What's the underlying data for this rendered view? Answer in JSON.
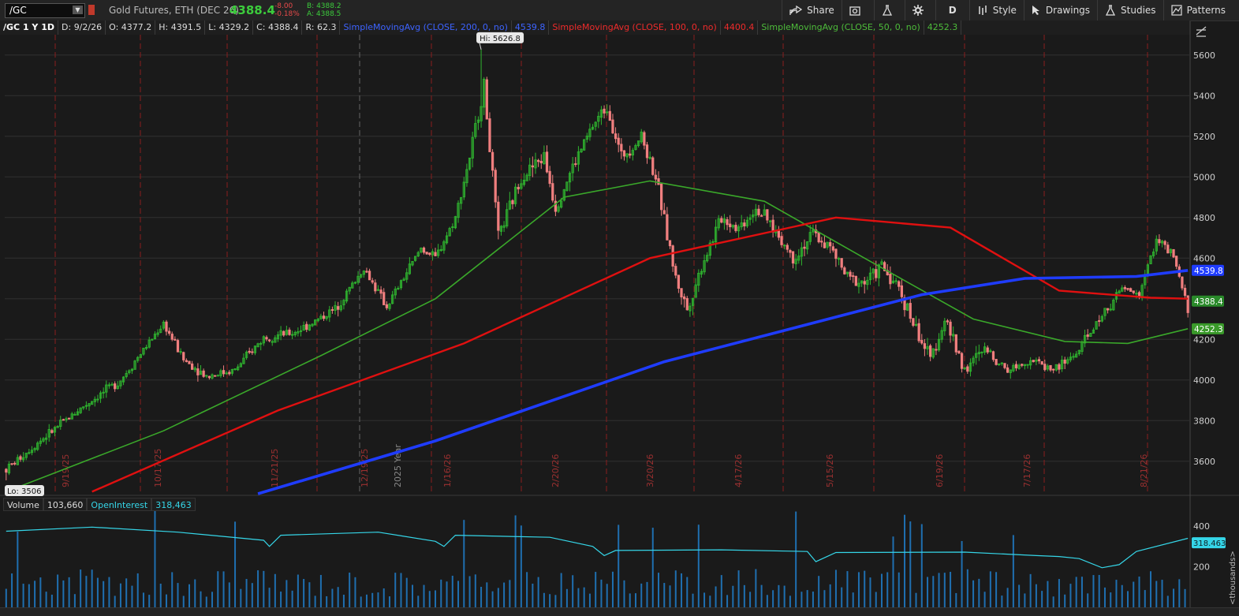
{
  "toolbar": {
    "symbol": "/GC",
    "instrument": "Gold Futures, ETH (DEC 26)",
    "last": "4388.4",
    "change": "-8.00",
    "change_pct": "-0.18%",
    "bid": "B: 4388.2",
    "ask": "A: 4388.5",
    "share": "Share",
    "period": "D",
    "style": "Style",
    "drawings": "Drawings",
    "studies": "Studies",
    "patterns": "Patterns"
  },
  "header": {
    "label": "/GC 1 Y 1D",
    "date": "D: 9/2/26",
    "open": "O: 4377.2",
    "high": "H: 4391.5",
    "low": "L: 4329.2",
    "close": "C: 4388.4",
    "range": "R: 62.3",
    "sma200_label": "SimpleMovingAvg (CLOSE, 200, 0, no)",
    "sma200_value": "4539.8",
    "sma100_label": "SimpleMovingAvg (CLOSE, 100, 0, no)",
    "sma100_value": "4400.4",
    "sma50_label": "SimpleMovingAvg (CLOSE, 50, 0, no)",
    "sma50_value": "4252.3"
  },
  "colors": {
    "up": "#2fb52f",
    "down": "#f07f7f",
    "sma200": "#1f3cff",
    "sma100": "#e01010",
    "sma50": "#3aa82a",
    "volume": "#1f6fb0",
    "oi": "#35d6e8",
    "grid": "#303030"
  },
  "volume_header": {
    "volume": "Volume",
    "volume_value": "103,660",
    "oi": "OpenInterest",
    "oi_value": "318,463"
  },
  "chart_data": {
    "type": "candlestick",
    "price_axis": {
      "ticks": [
        3600,
        3800,
        4000,
        4200,
        4400,
        4600,
        4800,
        5000,
        5200,
        5400,
        5600
      ],
      "ylim": [
        3440,
        5700
      ]
    },
    "date_labels": [
      "9/19/25",
      "10/17/25",
      "11/21/25",
      "12/19/25",
      "2025 Year",
      "1/16/26",
      "2/20/26",
      "3/20/26",
      "4/17/26",
      "5/15/26",
      "6/19/26",
      "7/17/26",
      "8/21/26"
    ],
    "hi_label": "Hi: 5626.8",
    "lo_label": "Lo: 3506",
    "price_badges": {
      "sma200": "4539.8",
      "last": "4388.4",
      "sma50": "4252.3"
    },
    "anchors": [
      [
        0,
        3560
      ],
      [
        10,
        3680
      ],
      [
        25,
        3850
      ],
      [
        40,
        4000
      ],
      [
        55,
        4280
      ],
      [
        62,
        4100
      ],
      [
        70,
        4020
      ],
      [
        80,
        4050
      ],
      [
        90,
        4210
      ],
      [
        100,
        4230
      ],
      [
        108,
        4290
      ],
      [
        115,
        4350
      ],
      [
        125,
        4550
      ],
      [
        133,
        4360
      ],
      [
        145,
        4650
      ],
      [
        150,
        4600
      ],
      [
        157,
        4800
      ],
      [
        162,
        5100
      ],
      [
        167,
        5450
      ],
      [
        172,
        4700
      ],
      [
        180,
        5000
      ],
      [
        188,
        5100
      ],
      [
        192,
        4850
      ],
      [
        198,
        5050
      ],
      [
        205,
        5250
      ],
      [
        210,
        5350
      ],
      [
        215,
        5100
      ],
      [
        222,
        5200
      ],
      [
        227,
        5000
      ],
      [
        234,
        4500
      ],
      [
        238,
        4350
      ],
      [
        244,
        4600
      ],
      [
        250,
        4800
      ],
      [
        256,
        4750
      ],
      [
        262,
        4850
      ],
      [
        268,
        4750
      ],
      [
        275,
        4600
      ],
      [
        282,
        4720
      ],
      [
        288,
        4650
      ],
      [
        294,
        4500
      ],
      [
        300,
        4480
      ],
      [
        306,
        4560
      ],
      [
        312,
        4450
      ],
      [
        318,
        4250
      ],
      [
        323,
        4100
      ],
      [
        328,
        4300
      ],
      [
        335,
        4050
      ],
      [
        342,
        4150
      ],
      [
        350,
        4050
      ],
      [
        358,
        4100
      ],
      [
        366,
        4050
      ],
      [
        374,
        4130
      ],
      [
        382,
        4300
      ],
      [
        390,
        4450
      ],
      [
        396,
        4420
      ],
      [
        402,
        4700
      ],
      [
        408,
        4600
      ],
      [
        413,
        4350
      ]
    ],
    "sma200": [
      [
        88,
        3440
      ],
      [
        150,
        3700
      ],
      [
        230,
        4090
      ],
      [
        320,
        4420
      ],
      [
        356,
        4500
      ],
      [
        395,
        4510
      ],
      [
        413,
        4539.8
      ]
    ],
    "sma100": [
      [
        30,
        3450
      ],
      [
        95,
        3850
      ],
      [
        160,
        4180
      ],
      [
        225,
        4600
      ],
      [
        290,
        4800
      ],
      [
        330,
        4750
      ],
      [
        368,
        4440
      ],
      [
        400,
        4405
      ],
      [
        413,
        4400.4
      ]
    ],
    "sma50": [
      [
        0,
        3450
      ],
      [
        55,
        3750
      ],
      [
        110,
        4120
      ],
      [
        150,
        4400
      ],
      [
        195,
        4900
      ],
      [
        225,
        4980
      ],
      [
        265,
        4880
      ],
      [
        300,
        4600
      ],
      [
        338,
        4300
      ],
      [
        370,
        4190
      ],
      [
        392,
        4180
      ],
      [
        413,
        4252.3
      ]
    ],
    "volume_axis": {
      "ticks": [
        200,
        400
      ],
      "unit": "<thousands>",
      "oi_badge": "318.463"
    }
  }
}
